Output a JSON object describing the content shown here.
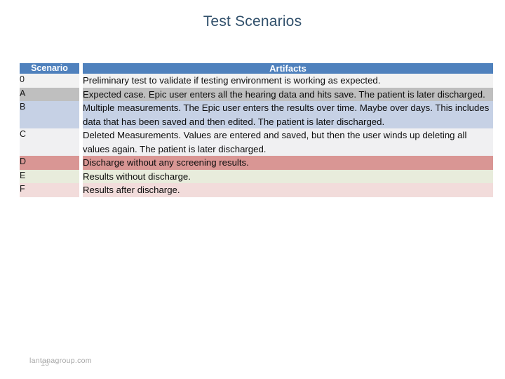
{
  "slide": {
    "title": "Test Scenarios",
    "title_color": "#31506b",
    "background": "#ffffff"
  },
  "table": {
    "header": {
      "scenario": "Scenario",
      "artifacts": "Artifacts",
      "bg": "#4f81bd",
      "text_color": "#ffffff"
    },
    "rows": [
      {
        "scenario": "0",
        "artifacts": "Preliminary test to validate if testing environment is working as expected.",
        "bg": "#f2f2f2"
      },
      {
        "scenario": "A",
        "artifacts": "Expected case. Epic user enters all the hearing data and hits save. The patient is later discharged.",
        "bg": "#bfbfbf"
      },
      {
        "scenario": "B",
        "artifacts": "Multiple measurements. The Epic user enters the results over time. Maybe over days. This includes data that has been saved and then edited. The patient is later discharged.",
        "bg": "#c6d1e5"
      },
      {
        "scenario": "C",
        "artifacts": "Deleted Measurements. Values are entered and saved, but then the user winds up deleting all values again. The patient is later discharged.",
        "bg": "#f0f0f2"
      },
      {
        "scenario": "D",
        "artifacts": "Discharge without any screening results.",
        "bg": "#d99694"
      },
      {
        "scenario": "E",
        "artifacts": "Results without discharge.",
        "bg": "#e8ecdc"
      },
      {
        "scenario": "F",
        "artifacts": "Results after discharge.",
        "bg": "#f2dcdb"
      }
    ]
  },
  "footer": {
    "url": "lantanagroup.com",
    "slide_number": "13"
  }
}
